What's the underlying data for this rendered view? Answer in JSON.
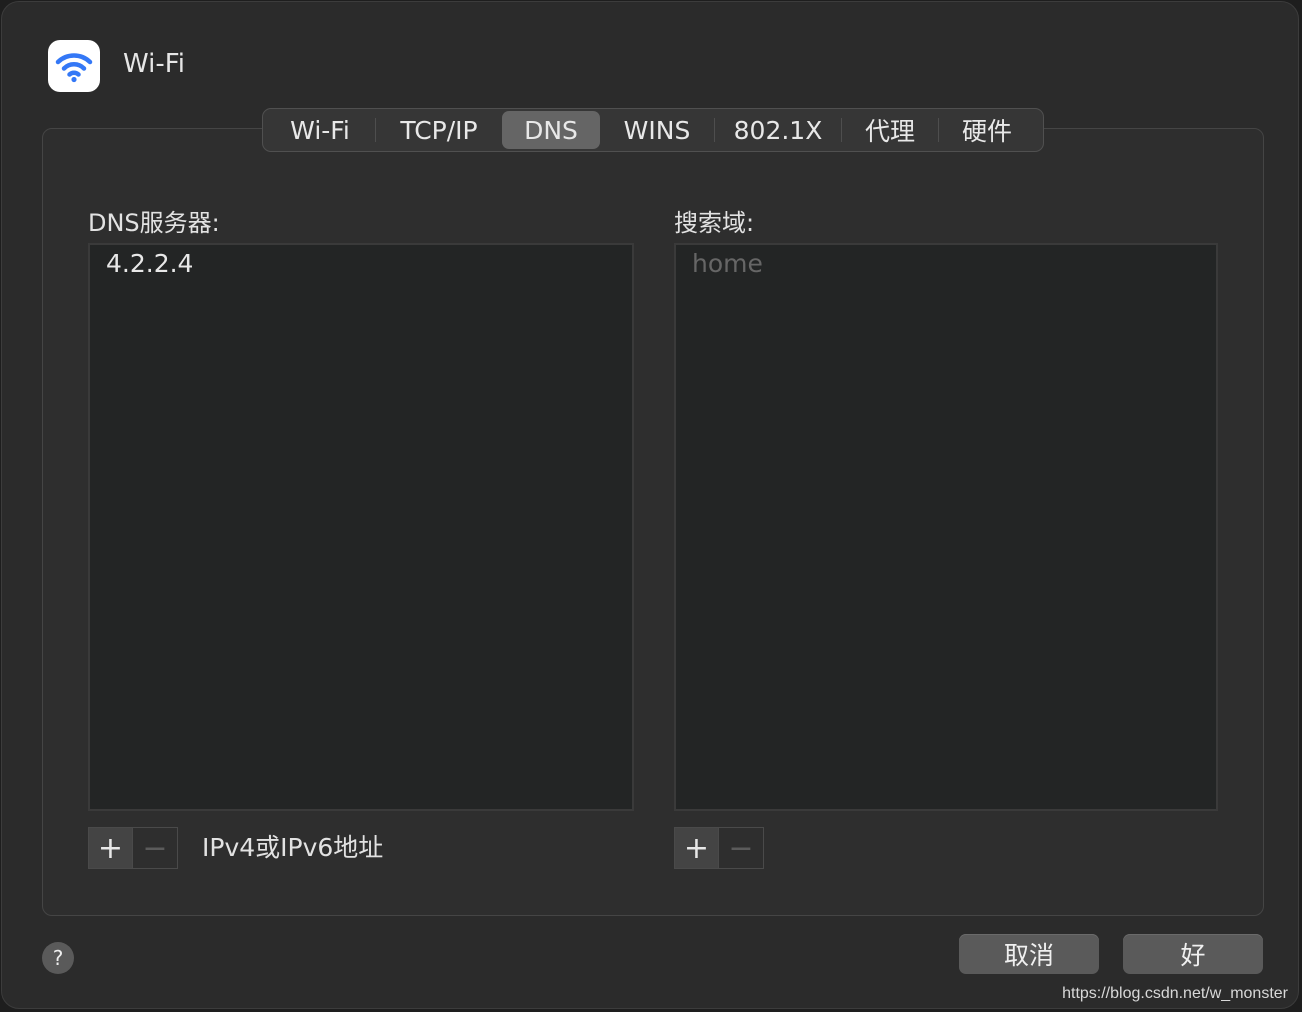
{
  "window": {
    "title": "Wi-Fi",
    "icon": "wifi-icon"
  },
  "tabs": [
    {
      "label": "Wi-Fi",
      "active": false
    },
    {
      "label": "TCP/IP",
      "active": false
    },
    {
      "label": "DNS",
      "active": true
    },
    {
      "label": "WINS",
      "active": false
    },
    {
      "label": "802.1X",
      "active": false
    },
    {
      "label": "代理",
      "active": false
    },
    {
      "label": "硬件",
      "active": false
    }
  ],
  "dns_servers": {
    "label": "DNS服务器:",
    "items": [
      "4.2.2.4"
    ],
    "add_label": "+",
    "remove_label": "−",
    "hint": "IPv4或IPv6地址"
  },
  "search_domains": {
    "label": "搜索域:",
    "placeholder": "home",
    "add_label": "+",
    "remove_label": "−"
  },
  "footer": {
    "help_label": "?",
    "cancel_label": "取消",
    "ok_label": "好"
  },
  "watermark": "https://blog.csdn.net/w_monster",
  "colors": {
    "accent_wifi": "#3478f6",
    "active_tab": "#656565",
    "window_bg": "#2b2b2b"
  }
}
